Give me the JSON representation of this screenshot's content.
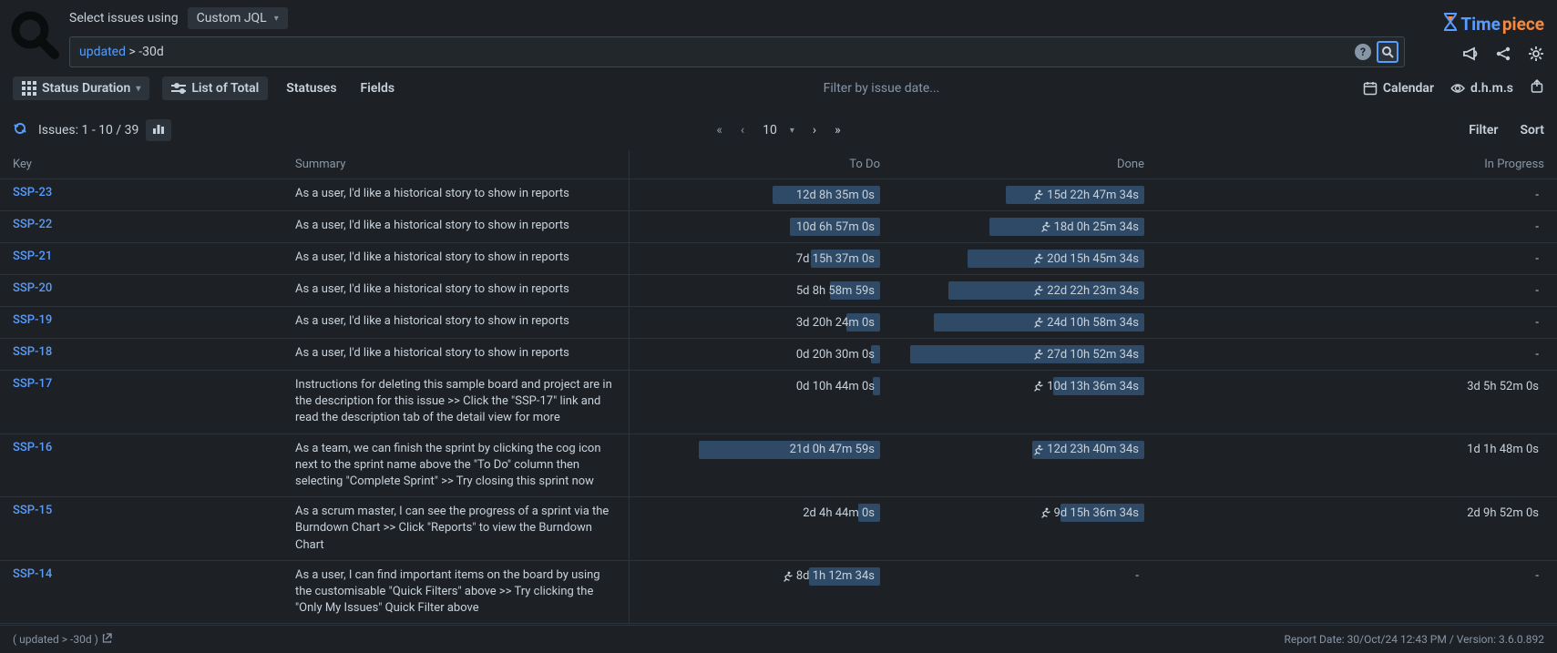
{
  "header": {
    "select_label": "Select issues using",
    "jql_mode": "Custom JQL",
    "search_keyword": "updated",
    "search_rest": " > -30d",
    "brand1": "Time",
    "brand2": "piece"
  },
  "toolbar": {
    "status_duration": "Status Duration",
    "list_of_total": "List of Total",
    "statuses": "Statuses",
    "fields": "Fields",
    "filter_placeholder": "Filter by issue date...",
    "calendar": "Calendar",
    "dhms": "d.h.m.s"
  },
  "subbar": {
    "issues_label": "Issues: 1 - 10 / 39",
    "page_size": "10",
    "filter": "Filter",
    "sort": "Sort"
  },
  "columns": {
    "key": "Key",
    "summary": "Summary",
    "todo": "To Do",
    "done": "Done",
    "in_progress": "In Progress"
  },
  "rows": [
    {
      "key": "SSP-23",
      "summary": "As a user, I'd like a historical story to show in reports",
      "todo": "12d 8h 35m 0s",
      "todo_w": 45,
      "todo_run": false,
      "done": "15d 22h 47m 34s",
      "done_w": 58,
      "done_run": true,
      "prog": "-",
      "prog_w": 0,
      "prog_run": false
    },
    {
      "key": "SSP-22",
      "summary": "As a user, I'd like a historical story to show in reports",
      "todo": "10d 6h 57m 0s",
      "todo_w": 38,
      "todo_run": false,
      "done": "18d 0h 25m 34s",
      "done_w": 65,
      "done_run": true,
      "prog": "-",
      "prog_w": 0,
      "prog_run": false
    },
    {
      "key": "SSP-21",
      "summary": "As a user, I'd like a historical story to show in reports",
      "todo": "7d 15h 37m 0s",
      "todo_w": 29,
      "todo_run": false,
      "done": "20d 15h 45m 34s",
      "done_w": 74,
      "done_run": true,
      "prog": "-",
      "prog_w": 0,
      "prog_run": false
    },
    {
      "key": "SSP-20",
      "summary": "As a user, I'd like a historical story to show in reports",
      "todo": "5d 8h 58m 59s",
      "todo_w": 21,
      "todo_run": false,
      "done": "22d 22h 23m 34s",
      "done_w": 82,
      "done_run": true,
      "prog": "-",
      "prog_w": 0,
      "prog_run": false
    },
    {
      "key": "SSP-19",
      "summary": "As a user, I'd like a historical story to show in reports",
      "todo": "3d 20h 24m 0s",
      "todo_w": 14,
      "todo_run": false,
      "done": "24d 10h 58m 34s",
      "done_w": 88,
      "done_run": true,
      "prog": "-",
      "prog_w": 0,
      "prog_run": false
    },
    {
      "key": "SSP-18",
      "summary": "As a user, I'd like a historical story to show in reports",
      "todo": "0d 20h 30m 0s",
      "todo_w": 4,
      "todo_run": false,
      "done": "27d 10h 52m 34s",
      "done_w": 98,
      "done_run": true,
      "prog": "-",
      "prog_w": 0,
      "prog_run": false
    },
    {
      "key": "SSP-17",
      "summary": "Instructions for deleting this sample board and project are in the description for this issue >> Click the \"SSP-17\" link and read the description tab of the detail view for more",
      "todo": "0d 10h 44m 0s",
      "todo_w": 3,
      "todo_run": false,
      "done": "10d 13h 36m 34s",
      "done_w": 38,
      "done_run": true,
      "prog": "3d 5h 52m 0s",
      "prog_w": 0,
      "prog_run": false
    },
    {
      "key": "SSP-16",
      "summary": "As a team, we can finish the sprint by clicking the cog icon next to the sprint name above the \"To Do\" column then selecting \"Complete Sprint\" >> Try closing this sprint now",
      "todo": "21d 0h 47m 59s",
      "todo_w": 76,
      "todo_run": false,
      "done": "12d 23h 40m 34s",
      "done_w": 47,
      "done_run": true,
      "prog": "1d 1h 48m 0s",
      "prog_w": 0,
      "prog_run": false
    },
    {
      "key": "SSP-15",
      "summary": "As a scrum master, I can see the progress of a sprint via the Burndown Chart >> Click \"Reports\" to view the Burndown Chart",
      "todo": "2d 4h 44m 0s",
      "todo_w": 9,
      "todo_run": false,
      "done": "9d 15h 36m 34s",
      "done_w": 35,
      "done_run": true,
      "prog": "2d 9h 52m 0s",
      "prog_w": 0,
      "prog_run": false
    },
    {
      "key": "SSP-14",
      "summary": "As a user, I can find important items on the board by using the customisable \"Quick Filters\" above >> Try clicking the \"Only My Issues\" Quick Filter above",
      "todo": "8d 1h 12m 34s",
      "todo_w": 30,
      "todo_run": true,
      "done": "-",
      "done_w": 0,
      "done_run": false,
      "prog": "-",
      "prog_w": 0,
      "prog_run": false
    }
  ],
  "footer": {
    "query": "( updated > -30d )",
    "report": "Report Date: 30/Oct/24 12:43 PM / Version: 3.6.0.892"
  }
}
